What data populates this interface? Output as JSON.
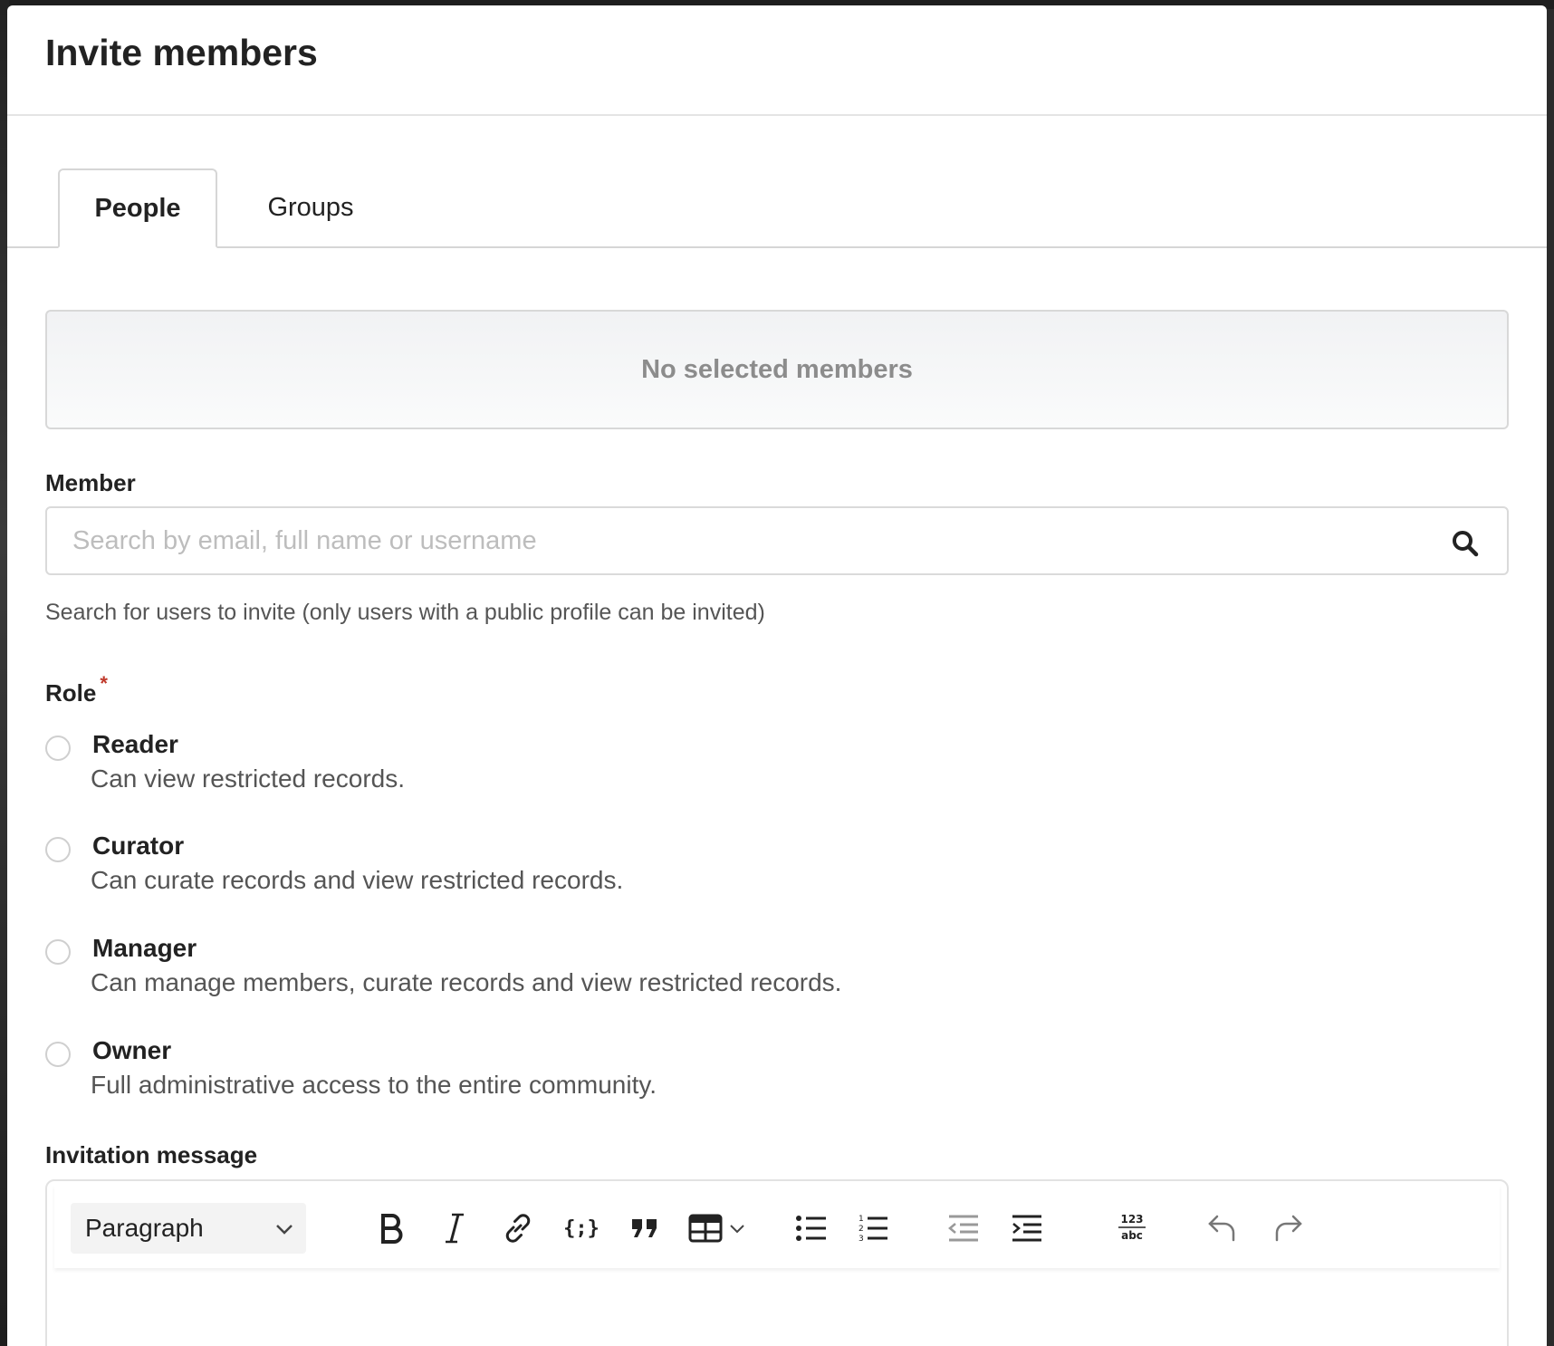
{
  "dialog": {
    "title": "Invite members"
  },
  "tabs": [
    {
      "label": "People",
      "active": true
    },
    {
      "label": "Groups",
      "active": false
    }
  ],
  "selected_members": {
    "empty_text": "No selected members"
  },
  "member_field": {
    "label": "Member",
    "placeholder": "Search by email, full name or username",
    "value": "",
    "help": "Search for users to invite (only users with a public profile can be invited)",
    "icon": "search-icon"
  },
  "role": {
    "label": "Role",
    "required_mark": "*",
    "options": [
      {
        "title": "Reader",
        "description": "Can view restricted records.",
        "selected": false
      },
      {
        "title": "Curator",
        "description": "Can curate records and view restricted records.",
        "selected": false
      },
      {
        "title": "Manager",
        "description": "Can manage members, curate records and view restricted records.",
        "selected": false
      },
      {
        "title": "Owner",
        "description": "Full administrative access to the entire community.",
        "selected": false
      }
    ]
  },
  "invitation_message": {
    "label": "Invitation message",
    "block_format": "Paragraph",
    "toolbar_icons": [
      "bold-icon",
      "italic-icon",
      "link-icon",
      "code-block-icon",
      "blockquote-icon",
      "table-icon",
      "bulleted-list-icon",
      "numbered-list-icon",
      "outdent-icon",
      "indent-icon",
      "special-characters-icon",
      "undo-icon",
      "redo-icon"
    ],
    "special_characters_glyph": {
      "top": "123",
      "bottom": "abc"
    }
  },
  "colors": {
    "required": "#c0392b",
    "muted_text": "#8c8c8c",
    "border": "#d6d6d6"
  }
}
